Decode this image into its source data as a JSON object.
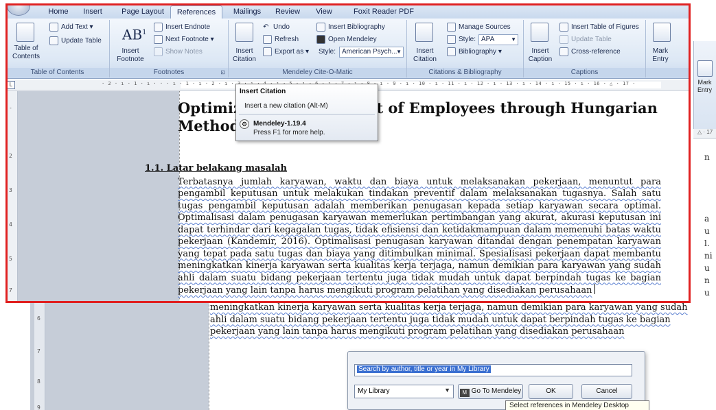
{
  "ribbon": {
    "tabs": [
      {
        "label": "Home"
      },
      {
        "label": "Insert"
      },
      {
        "label": "Page Layout"
      },
      {
        "label": "References"
      },
      {
        "label": "Mailings"
      },
      {
        "label": "Review"
      },
      {
        "label": "View"
      },
      {
        "label": "Foxit Reader PDF"
      }
    ],
    "active_tab": "References",
    "toc": {
      "toc_label": "Table of\nContents",
      "add_text": "Add Text",
      "update_table": "Update Table",
      "title": "Table of Contents"
    },
    "footnotes": {
      "insert_footnote": "Insert\nFootnote",
      "insert_endnote": "Insert Endnote",
      "next_footnote": "Next Footnote",
      "show_notes": "Show Notes",
      "title": "Footnotes"
    },
    "mendeley": {
      "insert_citation": "Insert\nCitation",
      "undo": "Undo",
      "refresh": "Refresh",
      "export_as": "Export as",
      "insert_bibliography": "Insert Bibliography",
      "open_mendeley": "Open Mendeley",
      "style_label": "Style:",
      "style_value": "American Psych...",
      "title": "Mendeley Cite-O-Matic"
    },
    "citations": {
      "insert_citation": "Insert\nCitation",
      "manage_sources": "Manage Sources",
      "style_label": "Style:",
      "style_value": "APA",
      "bibliography": "Bibliography",
      "title": "Citations & Bibliography"
    },
    "captions": {
      "insert_caption": "Insert\nCaption",
      "insert_table_of_figures": "Insert Table of Figures",
      "update_table": "Update Table",
      "cross_reference": "Cross-reference",
      "title": "Captions"
    },
    "index": {
      "mark_entry": "Mark\nEntry"
    }
  },
  "ruler": {
    "corner": "L",
    "numbers": "· 2 · ı · 1 · ı · · · ı · 1 · ı · 2 · ı · 3 · ı · 4 · ı · 5 · ı · 6 · ı · 7 · ı · 8 · ı · 9 · ı · 10 · ı · 11 · ı · 12 · ı · 13 · ı · 14 · ı · 15 · ı · 16 · △ · 17 ·"
  },
  "tooltip": {
    "title": "Insert Citation",
    "description": "Insert a new citation (Alt-M)",
    "addin": "Mendeley-1.19.4",
    "help": "Press F1 for more help."
  },
  "document": {
    "title": "Optimization Assignment of Employees through Hungarian Method",
    "heading": "1.1. Latar belakang masalah",
    "body": "Terbatasnya jumlah karyawan, waktu dan biaya untuk melaksanakan pekerjaan, menuntut para pengambil keputusan untuk melakukan tindakan preventif dalam melaksanakan tugasnya. Salah satu tugas pengambil keputusan adalah memberikan penugasan kepada setiap karyawan secara optimal. Optimalisasi dalam penugasan karyawan memerlukan pertimbangan yang akurat, akurasi keputusan ini dapat terhindar dari kegagalan tugas, tidak efisiensi dan ketidakmampuan dalam memenuhi batas waktu pekerjaan (Kandemir, 2016). Optimalisasi penugasan karyawan ditandai dengan penempatan karyawan yang tepat pada satu tugas dan biaya yang ditimbulkan minimal. Spesialisasi pekerjaan dapat membantu meningkatkan kinerja karyawan serta kualitas kerja terjaga, namun demikian para karyawan yang sudah ahli dalam suatu bidang pekerjaan tertentu juga tidak mudah untuk dapat berpindah tugas ke bagian pekerjaan yang lain tanpa harus mengikuti program pelatihan yang disediakan perusahaan"
  },
  "background": {
    "text_lines": [
      "meningkatkan kinerja karyawan serta kualitas kerja terjaga, namun demikian para karyawan yang sudah",
      "ahli dalam suatu bidang pekerjaan tertentu juga tidak mudah untuk dapat berpindah tugas ke bagian",
      "pekerjaan yang lain tanpa harus mengikuti program pelatihan yang disediakan perusahaan"
    ],
    "right_chars": [
      "n",
      "a",
      "u",
      "l.",
      "ni",
      "u",
      "n",
      "u"
    ],
    "mark_entry": "Mark\nEntry",
    "ruler_tick": "△ · 17",
    "vruler_nums": [
      "6",
      "7",
      "8",
      "9"
    ]
  },
  "dialog": {
    "search_placeholder": "Search by author, title or year in My Library",
    "library_value": "My Library",
    "go_to_mendeley": "Go To Mendeley",
    "ok": "OK",
    "cancel": "Cancel",
    "tooltip": "Select references in Mendeley Desktop"
  }
}
